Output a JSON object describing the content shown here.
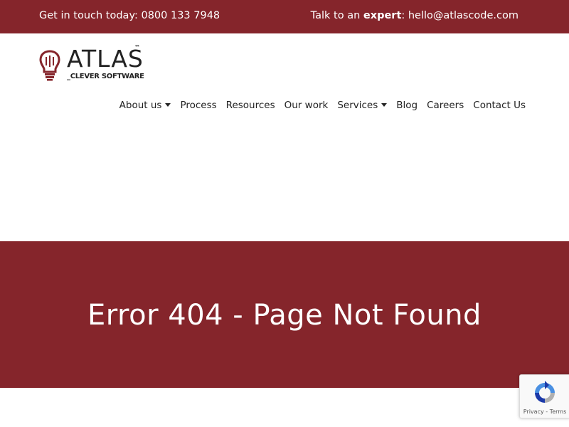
{
  "topbar": {
    "phone_text": "Get in touch today: 0800 133 7948",
    "talk_prefix": "Talk to an ",
    "talk_bold": "expert",
    "talk_suffix": ": hello@atlascode.com",
    "background": "#85252b"
  },
  "logo": {
    "word": "ATLAS",
    "tm": "™",
    "tagline": "_CLEVER SOFTWARE",
    "icon": "lightbulb-head-icon"
  },
  "nav": {
    "items": [
      {
        "label": "About us",
        "dropdown": true
      },
      {
        "label": "Process",
        "dropdown": false
      },
      {
        "label": "Resources",
        "dropdown": false
      },
      {
        "label": "Our work",
        "dropdown": false
      },
      {
        "label": "Services",
        "dropdown": true
      },
      {
        "label": "Blog",
        "dropdown": false
      },
      {
        "label": "Careers",
        "dropdown": false
      },
      {
        "label": "Contact Us",
        "dropdown": false
      }
    ]
  },
  "hero": {
    "title": "Error 404 - Page Not Found",
    "background": "#85252b"
  },
  "recaptcha": {
    "icon": "recaptcha-icon",
    "privacy": "Privacy",
    "separator": " - ",
    "terms": "Terms"
  }
}
